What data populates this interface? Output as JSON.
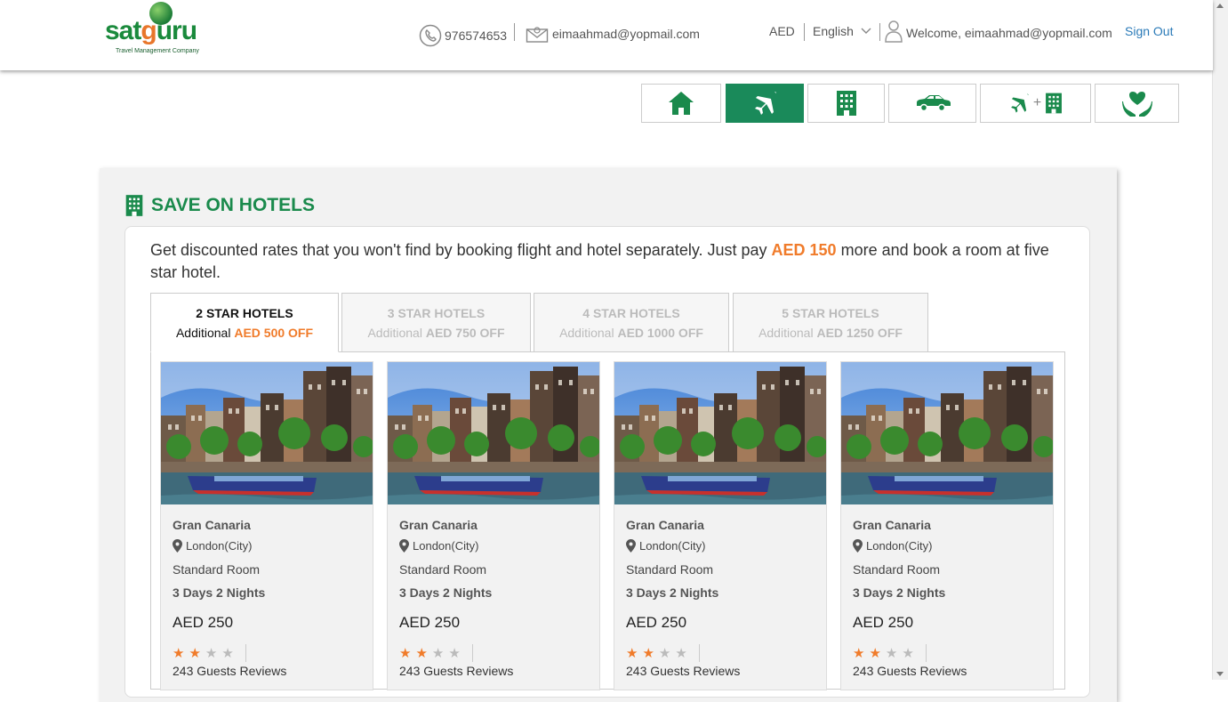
{
  "header": {
    "brand": "satguru",
    "brand_tagline": "Travel Management Company",
    "phone": "976574653",
    "email": "eimaahmad@yopmail.com",
    "currency": "AED",
    "language": "English",
    "welcome": "Welcome, eimaahmad@yopmail.com",
    "sign_out": "Sign Out"
  },
  "nav": {
    "items": [
      {
        "name": "home",
        "icon": "home-icon",
        "active": false
      },
      {
        "name": "flights",
        "icon": "plane-icon",
        "active": true
      },
      {
        "name": "hotels",
        "icon": "building-icon",
        "active": false
      },
      {
        "name": "cars",
        "icon": "car-icon",
        "active": false
      },
      {
        "name": "flight-hotel",
        "icon": "plane-plus-building-icon",
        "active": false
      },
      {
        "name": "insurance",
        "icon": "heart-hands-icon",
        "active": false
      }
    ],
    "plus": "+"
  },
  "section": {
    "title": "SAVE ON HOTELS",
    "desc_before": "Get discounted rates that you won't find by booking flight and hotel separately. Just pay ",
    "desc_highlight": "AED 150",
    "desc_after": " more and book a room at five star hotel."
  },
  "tabs": [
    {
      "title": "2 STAR HOTELS",
      "prefix": "Additional ",
      "amount": "AED 500 OFF",
      "active": true
    },
    {
      "title": "3 STAR HOTELS",
      "prefix": "Additional ",
      "amount": "AED 750 OFF",
      "active": false
    },
    {
      "title": "4 STAR HOTELS",
      "prefix": "Additional ",
      "amount": "AED 1000 OFF",
      "active": false
    },
    {
      "title": "5 STAR HOTELS",
      "prefix": "Additional ",
      "amount": "AED 1250 OFF",
      "active": false
    }
  ],
  "hotels": [
    {
      "name": "Gran Canaria",
      "location": "London(City)",
      "room": "Standard Room",
      "duration": "3 Days 2 Nights",
      "price": "AED 250",
      "rating": 2,
      "max_rating": 4,
      "reviews": "243 Guests Reviews"
    },
    {
      "name": "Gran Canaria",
      "location": "London(City)",
      "room": "Standard Room",
      "duration": "3 Days 2 Nights",
      "price": "AED 250",
      "rating": 2,
      "max_rating": 4,
      "reviews": "243 Guests Reviews"
    },
    {
      "name": "Gran Canaria",
      "location": "London(City)",
      "room": "Standard Room",
      "duration": "3 Days 2 Nights",
      "price": "AED 250",
      "rating": 2,
      "max_rating": 4,
      "reviews": "243 Guests Reviews"
    },
    {
      "name": "Gran Canaria",
      "location": "London(City)",
      "room": "Standard Room",
      "duration": "3 Days 2 Nights",
      "price": "AED 250",
      "rating": 2,
      "max_rating": 4,
      "reviews": "243 Guests Reviews"
    }
  ],
  "colors": {
    "brand_green": "#1a8a4c",
    "nav_active": "#1a8a5a",
    "accent_orange": "#f07b2a",
    "link_blue": "#2a7ab8"
  }
}
